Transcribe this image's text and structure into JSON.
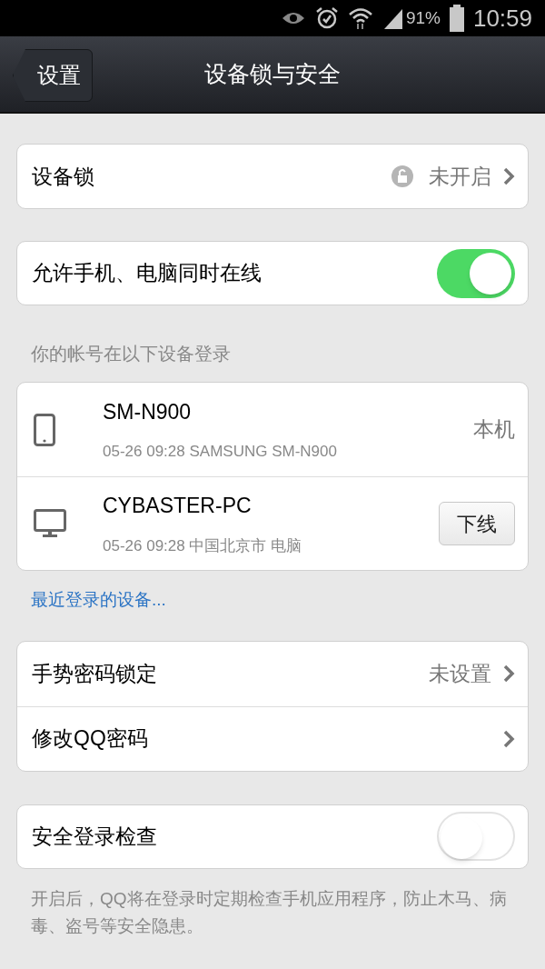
{
  "status_bar": {
    "battery": "91%",
    "time": "10:59"
  },
  "nav": {
    "back": "设置",
    "title": "设备锁与安全"
  },
  "device_lock": {
    "label": "设备锁",
    "value": "未开启"
  },
  "allow_both": {
    "label": "允许手机、电脑同时在线",
    "on": true
  },
  "devices_header": "你的帐号在以下设备登录",
  "devices": [
    {
      "kind": "phone",
      "name": "SM-N900",
      "detail": "05-26 09:28 SAMSUNG SM-N900",
      "action": {
        "kind": "label",
        "text": "本机"
      }
    },
    {
      "kind": "desktop",
      "name": "CYBASTER-PC",
      "detail": "05-26 09:28 中国北京市 电脑",
      "action": {
        "kind": "button",
        "text": "下线"
      }
    }
  ],
  "recent_link": "最近登录的设备...",
  "settings": [
    {
      "label": "手势密码锁定",
      "value": "未设置"
    },
    {
      "label": "修改QQ密码"
    }
  ],
  "safe_check": {
    "label": "安全登录检查",
    "on": false
  },
  "footer": "开启后，QQ将在登录时定期检查手机应用程序，防止木马、病毒、盗号等安全隐患。"
}
